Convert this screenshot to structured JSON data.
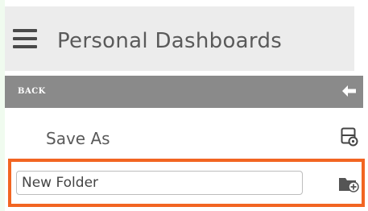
{
  "header": {
    "title": "Personal Dashboards"
  },
  "backbar": {
    "label": "BACK"
  },
  "save_as": {
    "label": "Save As"
  },
  "new_folder": {
    "value": "",
    "placeholder": "New Folder"
  },
  "colors": {
    "header_bg": "#ececec",
    "backbar_bg": "#8a8a8a",
    "highlight_border": "#f26522",
    "text": "#5a5a5a"
  },
  "icons": {
    "menu": "hamburger-icon",
    "back": "back-arrow-icon",
    "save_as": "save-as-icon",
    "new_folder": "new-folder-icon"
  }
}
